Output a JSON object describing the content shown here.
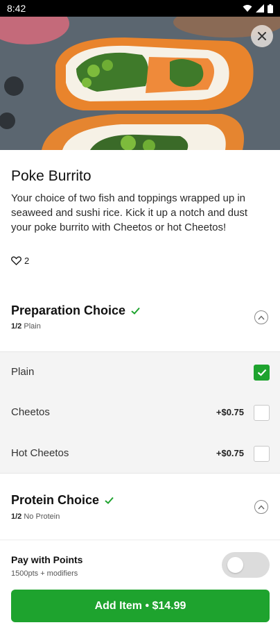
{
  "status_bar": {
    "time": "8:42",
    "icons": [
      "wifi-icon",
      "signal-icon",
      "battery-icon"
    ]
  },
  "hero": {
    "image": "poke-burrito-photo",
    "close_icon": "close-icon"
  },
  "item": {
    "title": "Poke Burrito",
    "description": "Your choice of two fish and toppings wrapped up in seaweed and sushi rice. Kick it up a notch and dust your poke burrito with Cheetos or hot Cheetos!",
    "likes": "2"
  },
  "groups": [
    {
      "title": "Preparation Choice",
      "count": "1/2",
      "selected": "Plain",
      "complete": true,
      "options": [
        {
          "label": "Plain",
          "price": "",
          "checked": true
        },
        {
          "label": "Cheetos",
          "price": "+$0.75",
          "checked": false
        },
        {
          "label": "Hot Cheetos",
          "price": "+$0.75",
          "checked": false
        }
      ]
    },
    {
      "title": "Protein Choice",
      "count": "1/2",
      "selected": "No Protein",
      "complete": true
    }
  ],
  "footer": {
    "pay_title": "Pay with Points",
    "pay_sub": "1500pts + modifiers",
    "toggle_on": false,
    "add_button": "Add Item • $14.99"
  },
  "colors": {
    "accent": "#1ea32e",
    "check_mark": "#1ea32e"
  }
}
